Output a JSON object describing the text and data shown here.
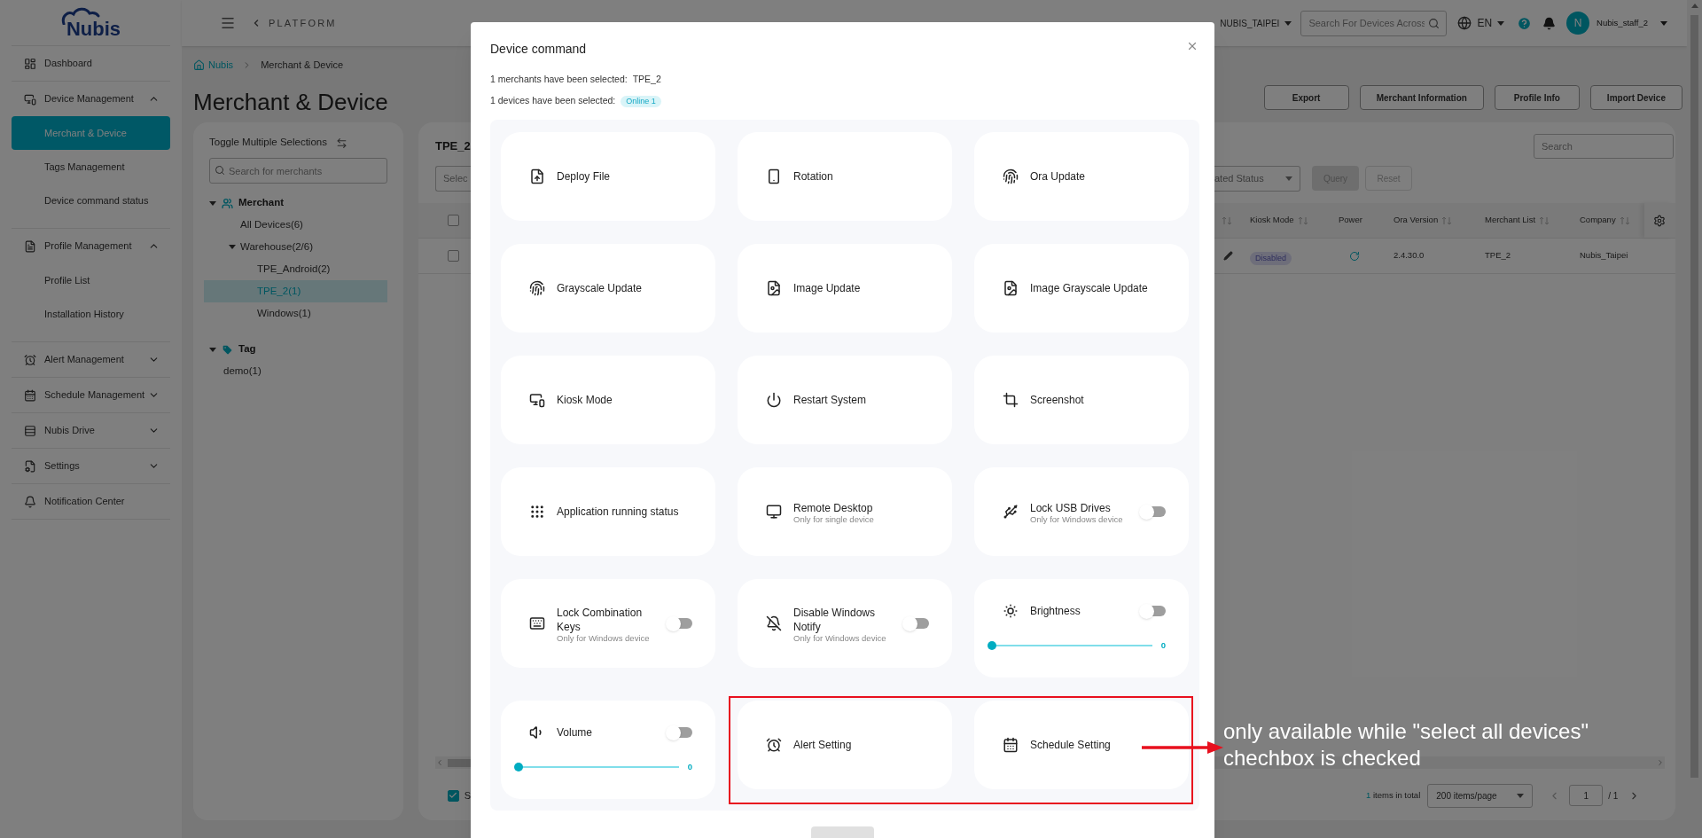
{
  "sidebar": {
    "logo": "Nubis",
    "sections": [
      {
        "label": "Dashboard",
        "kind": "link"
      },
      {
        "label": "Device Management",
        "kind": "group",
        "expanded": true,
        "children": [
          {
            "label": "Merchant & Device",
            "selected": true
          },
          {
            "label": "Tags Management",
            "selected": false
          },
          {
            "label": "Device command status",
            "selected": false
          }
        ]
      },
      {
        "label": "Profile Management",
        "kind": "group",
        "expanded": true,
        "children": [
          {
            "label": "Profile List",
            "selected": false
          },
          {
            "label": "Installation History",
            "selected": false
          }
        ]
      },
      {
        "label": "Alert Management",
        "kind": "group",
        "expanded": false
      },
      {
        "label": "Schedule Management",
        "kind": "group",
        "expanded": false
      },
      {
        "label": "Nubis Drive",
        "kind": "group",
        "expanded": false
      },
      {
        "label": "Settings",
        "kind": "group",
        "expanded": false
      },
      {
        "label": "Notification Center",
        "kind": "link"
      }
    ]
  },
  "header": {
    "platform": "PLATFORM",
    "company": "NUBIS_TAIPEI",
    "search_placeholder": "Search For Devices Across",
    "language": "EN",
    "avatar_initial": "N",
    "user": "Nubis_staff_2"
  },
  "breadcrumb": [
    "Nubis",
    "Merchant & Device"
  ],
  "page_title": "Merchant & Device",
  "actions": [
    "Export",
    "Merchant Information",
    "Profile Info",
    "Import Device"
  ],
  "tree_panel": {
    "toggle_label": "Toggle Multiple Selections",
    "search_placeholder": "Search for merchants",
    "sections": [
      {
        "label": "Merchant",
        "expanded": true,
        "children": [
          {
            "label": "All Devices(6)",
            "selected": false
          },
          {
            "label": "Warehouse(2/6)",
            "selected": false,
            "expanded": true,
            "children": [
              {
                "label": "TPE_Android(2)",
                "selected": false
              },
              {
                "label": "TPE_2(1)",
                "selected": true
              },
              {
                "label": "Windows(1)",
                "selected": false
              }
            ]
          }
        ]
      },
      {
        "label": "Tag",
        "expanded": true,
        "children": [
          {
            "label": "demo(1)",
            "selected": false
          }
        ]
      }
    ]
  },
  "device_panel": {
    "title": "TPE_2",
    "filter_placeholder": "Selec",
    "status_filter": "ated Status",
    "search_placeholder": "Search",
    "query": "Query",
    "reset": "Reset",
    "columns": [
      "Kiosk Mode",
      "Power",
      "Ora Version",
      "Merchant List",
      "Company"
    ],
    "header_checked": false,
    "rows": [
      {
        "checked": false,
        "kiosk_mode": "Disabled",
        "ora_version": "2.4.30.0",
        "merchant_list": "TPE_2",
        "company": "Nubis_Taipei"
      }
    ],
    "select_all": {
      "checked": true,
      "label": "S"
    },
    "total": {
      "count": "1",
      "label": "items in total"
    },
    "page_size": "200 items/page",
    "page": "1",
    "pages": "/ 1"
  },
  "dialog": {
    "title": "Device command",
    "merchants": {
      "label": "1 merchants have been selected:",
      "value": "TPE_2"
    },
    "devices": {
      "label": "1 devices have been selected:",
      "badge": "Online 1"
    },
    "commands": [
      {
        "kind": "plain",
        "label": "Deploy File"
      },
      {
        "kind": "plain",
        "label": "Rotation"
      },
      {
        "kind": "plain",
        "label": "Ora Update"
      },
      {
        "kind": "plain",
        "label": "Grayscale Update"
      },
      {
        "kind": "plain",
        "label": "Image Update"
      },
      {
        "kind": "plain",
        "label": "Image Grayscale Update"
      },
      {
        "kind": "plain",
        "label": "Kiosk Mode"
      },
      {
        "kind": "plain",
        "label": "Restart System"
      },
      {
        "kind": "plain",
        "label": "Screenshot"
      },
      {
        "kind": "plain",
        "label": "Application running status"
      },
      {
        "kind": "plain",
        "label": "Remote Desktop",
        "note": "Only for single device"
      },
      {
        "kind": "toggle",
        "label": "Lock USB Drives",
        "note": "Only for Windows device",
        "on": false
      },
      {
        "kind": "toggle",
        "label": "Lock Combination Keys",
        "note": "Only for Windows device",
        "on": false
      },
      {
        "kind": "toggle",
        "label": "Disable Windows Notify",
        "note": "Only for Windows device",
        "on": false
      },
      {
        "kind": "slider",
        "label": "Brightness",
        "on": false,
        "level": 0,
        "reading": "0"
      },
      {
        "kind": "slider",
        "label": "Volume",
        "on": false,
        "level": 0,
        "reading": "0"
      },
      {
        "kind": "plain",
        "label": "Alert Setting"
      },
      {
        "kind": "plain",
        "label": "Schedule Setting"
      }
    ]
  },
  "annotation": {
    "text": "only available while \"select all devices\" chechbox is checked"
  }
}
